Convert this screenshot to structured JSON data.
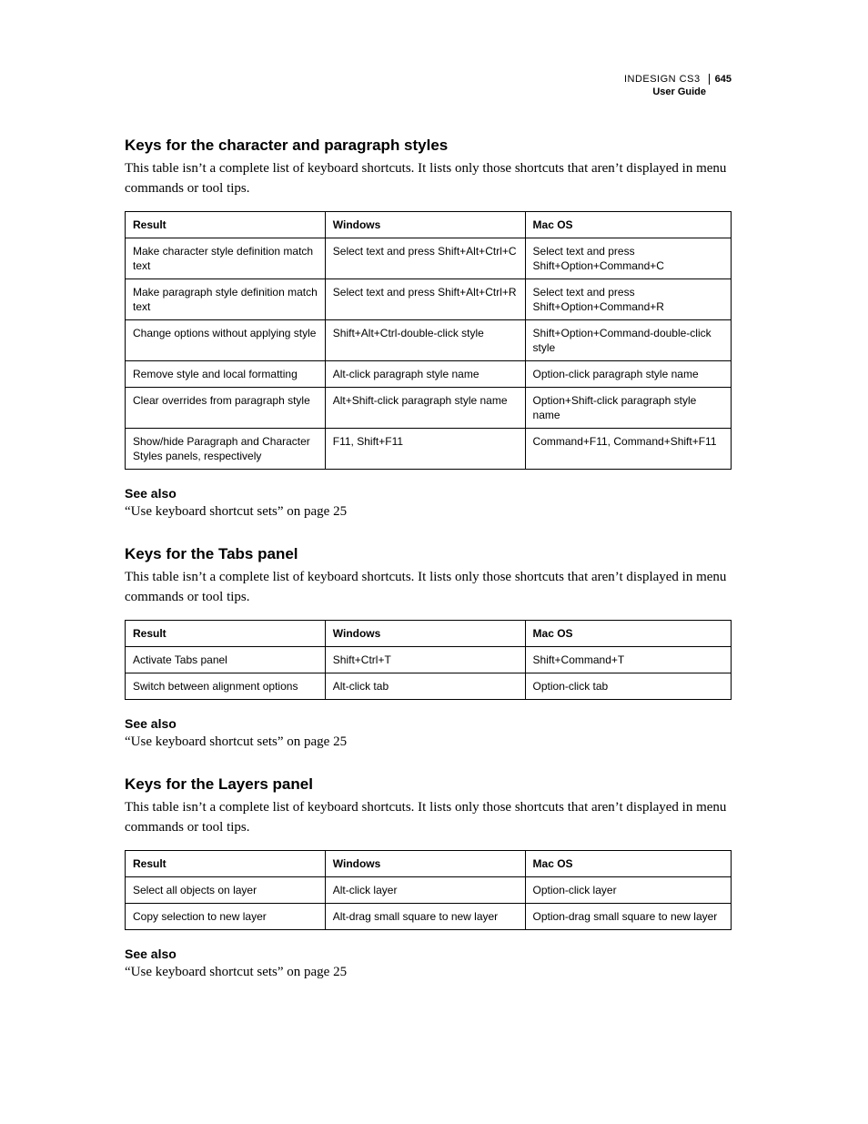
{
  "header": {
    "product": "INDESIGN CS3",
    "page_number": "645",
    "guide": "User Guide"
  },
  "sections": [
    {
      "title": "Keys for the character and paragraph styles",
      "intro": "This table isn’t a complete list of keyboard shortcuts. It lists only those shortcuts that aren’t displayed in menu commands or tool tips.",
      "columns": [
        "Result",
        "Windows",
        "Mac OS"
      ],
      "rows": [
        [
          "Make character style definition match text",
          "Select text and press Shift+Alt+Ctrl+C",
          "Select text and press Shift+Option+Command+C"
        ],
        [
          "Make paragraph style definition match text",
          "Select text and press Shift+Alt+Ctrl+R",
          "Select text and press Shift+Option+Command+R"
        ],
        [
          "Change options without applying style",
          "Shift+Alt+Ctrl-double-click style",
          "Shift+Option+Command-double-click style"
        ],
        [
          "Remove style and local formatting",
          "Alt-click paragraph style name",
          "Option-click paragraph style name"
        ],
        [
          "Clear overrides from paragraph style",
          "Alt+Shift-click paragraph style name",
          "Option+Shift-click paragraph style name"
        ],
        [
          "Show/hide Paragraph and Character Styles panels, respectively",
          "F11, Shift+F11",
          "Command+F11, Command+Shift+F11"
        ]
      ],
      "see_also_heading": "See also",
      "see_also_link": "“Use keyboard shortcut sets” on page 25"
    },
    {
      "title": "Keys for the Tabs panel",
      "intro": "This table isn’t a complete list of keyboard shortcuts. It lists only those shortcuts that aren’t displayed in menu commands or tool tips.",
      "columns": [
        "Result",
        "Windows",
        "Mac OS"
      ],
      "rows": [
        [
          "Activate Tabs panel",
          "Shift+Ctrl+T",
          "Shift+Command+T"
        ],
        [
          "Switch between alignment options",
          "Alt-click tab",
          "Option-click tab"
        ]
      ],
      "see_also_heading": "See also",
      "see_also_link": "“Use keyboard shortcut sets” on page 25"
    },
    {
      "title": "Keys for the Layers panel",
      "intro": "This table isn’t a complete list of keyboard shortcuts. It lists only those shortcuts that aren’t displayed in menu commands or tool tips.",
      "columns": [
        "Result",
        "Windows",
        "Mac OS"
      ],
      "rows": [
        [
          "Select all objects on layer",
          "Alt-click layer",
          "Option-click layer"
        ],
        [
          "Copy selection to new layer",
          "Alt-drag small square to new layer",
          "Option-drag small square to new layer"
        ]
      ],
      "see_also_heading": "See also",
      "see_also_link": "“Use keyboard shortcut sets” on page 25"
    }
  ]
}
